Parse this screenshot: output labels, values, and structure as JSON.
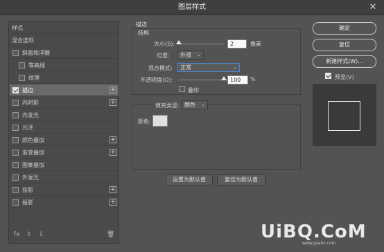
{
  "window": {
    "title": "图层样式",
    "close_glyph": "✕"
  },
  "sidebar": {
    "items": [
      {
        "label": "样式",
        "checkbox": false,
        "checked": false,
        "plus": false,
        "selected": false,
        "indent": 0
      },
      {
        "label": "混合选项",
        "checkbox": false,
        "checked": false,
        "plus": false,
        "selected": false,
        "indent": 0
      },
      {
        "label": "斜面和浮雕",
        "checkbox": true,
        "checked": false,
        "plus": false,
        "selected": false,
        "indent": 0
      },
      {
        "label": "等高线",
        "checkbox": true,
        "checked": false,
        "plus": false,
        "selected": false,
        "indent": 1
      },
      {
        "label": "纹理",
        "checkbox": true,
        "checked": false,
        "plus": false,
        "selected": false,
        "indent": 1
      },
      {
        "label": "描边",
        "checkbox": true,
        "checked": true,
        "plus": true,
        "selected": true,
        "indent": 0
      },
      {
        "label": "内阴影",
        "checkbox": true,
        "checked": false,
        "plus": true,
        "selected": false,
        "indent": 0
      },
      {
        "label": "内发光",
        "checkbox": true,
        "checked": false,
        "plus": false,
        "selected": false,
        "indent": 0
      },
      {
        "label": "光泽",
        "checkbox": true,
        "checked": false,
        "plus": false,
        "selected": false,
        "indent": 0
      },
      {
        "label": "颜色叠加",
        "checkbox": true,
        "checked": false,
        "plus": true,
        "selected": false,
        "indent": 0
      },
      {
        "label": "渐变叠加",
        "checkbox": true,
        "checked": false,
        "plus": true,
        "selected": false,
        "indent": 0
      },
      {
        "label": "图案叠加",
        "checkbox": true,
        "checked": false,
        "plus": false,
        "selected": false,
        "indent": 0
      },
      {
        "label": "外发光",
        "checkbox": true,
        "checked": false,
        "plus": false,
        "selected": false,
        "indent": 0
      },
      {
        "label": "投影",
        "checkbox": true,
        "checked": false,
        "plus": true,
        "selected": false,
        "indent": 0
      },
      {
        "label": "投影",
        "checkbox": true,
        "checked": false,
        "plus": true,
        "selected": false,
        "indent": 0
      }
    ],
    "toolbar": {
      "fx": "fx",
      "up": "⇧",
      "down": "⇩",
      "trash": "🗑"
    }
  },
  "stroke": {
    "section_title": "描边",
    "structure_title": "结构",
    "size_label": "大小(S):",
    "size_value": "2",
    "size_unit": "像素",
    "size_level": 0.02,
    "position_label": "位置:",
    "position_value": "外部",
    "blend_label": "混合模式:",
    "blend_value": "正常",
    "opacity_label": "不透明度(O):",
    "opacity_value": "100",
    "opacity_unit": "%",
    "opacity_level": 1.0,
    "overprint_label": "叠印",
    "overprint_checked": false,
    "fill_type_label": "填充类型:",
    "fill_type_value": "颜色",
    "color_label": "颜色:",
    "color_value": "#e0e0e0",
    "set_default_label": "设置为默认值",
    "reset_default_label": "复位为默认值"
  },
  "buttons": {
    "ok": "确定",
    "reset": "复位",
    "new_style": "新建样式(W)...",
    "preview_label": "预览(V)",
    "preview_checked": true
  },
  "watermark": {
    "logo": "UiBQ.CoM",
    "url": "www.psahz.com"
  },
  "colors": {
    "accent": "#4a8ad6",
    "panel": "#535353",
    "dark": "#3a3a3a"
  }
}
